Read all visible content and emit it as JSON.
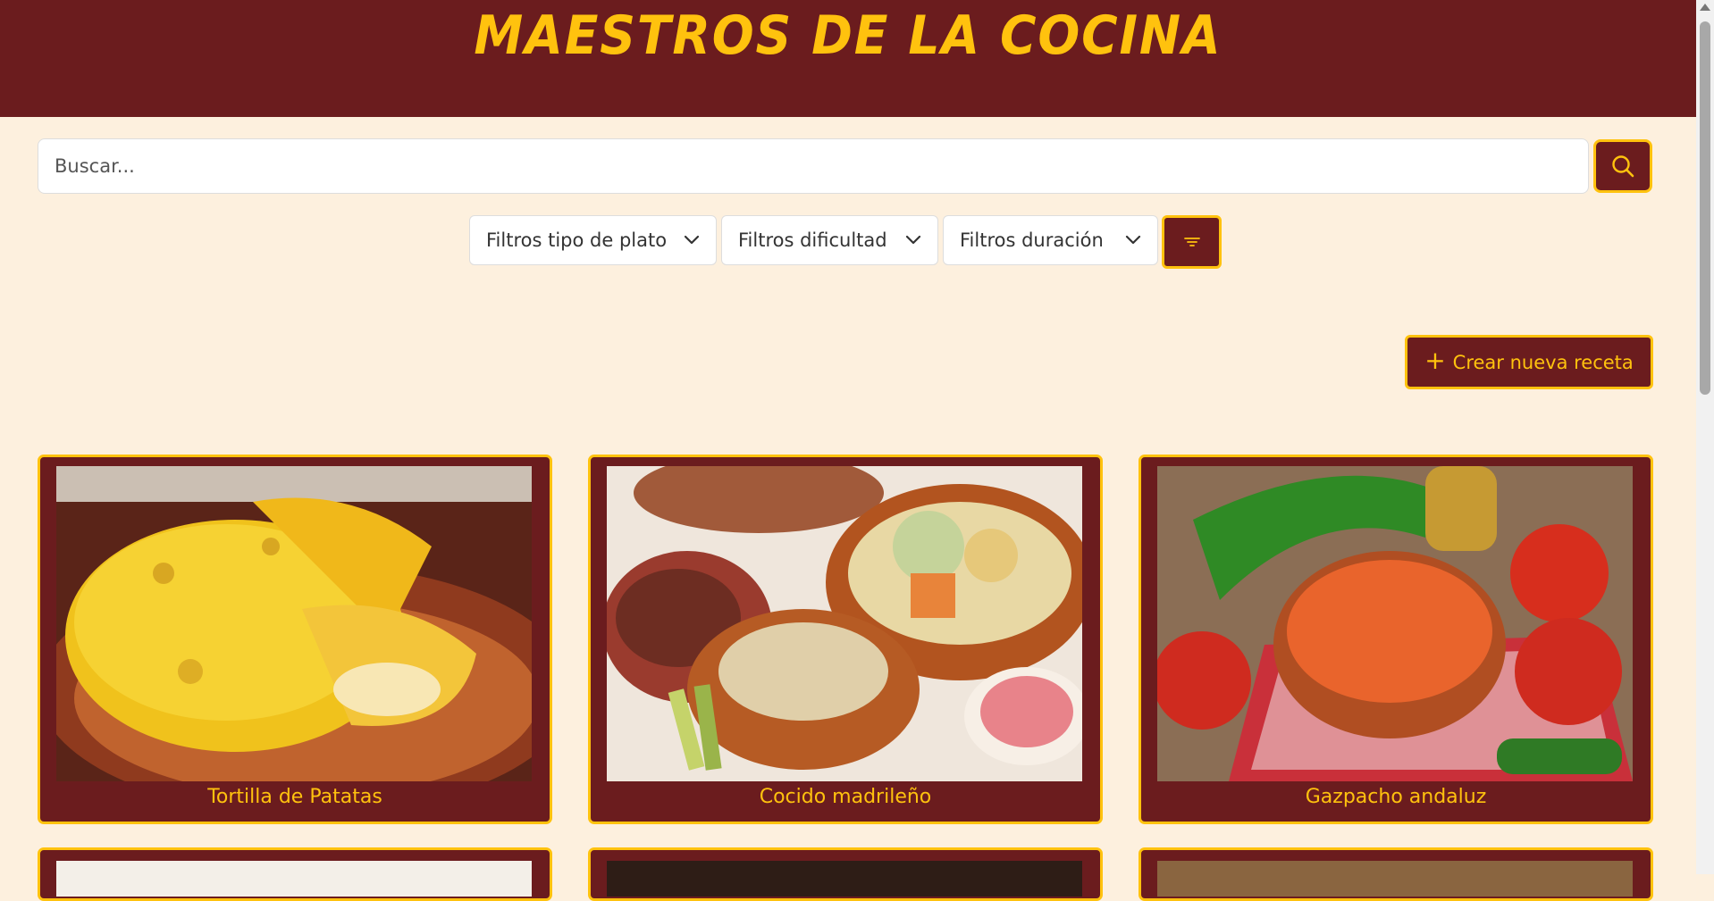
{
  "header": {
    "title": "MAESTROS DE LA COCINA"
  },
  "search": {
    "placeholder": "Buscar..."
  },
  "filters": [
    {
      "label": "Filtros tipo de plato"
    },
    {
      "label": "Filtros dificultad"
    },
    {
      "label": "Filtros duración"
    }
  ],
  "actions": {
    "create_label": "Crear nueva receta"
  },
  "recipes": [
    {
      "title": "Tortilla de Patatas"
    },
    {
      "title": "Cocido madrileño"
    },
    {
      "title": "Gazpacho andaluz"
    }
  ],
  "colors": {
    "brand": "#6b1c1e",
    "accent": "#ffc20e",
    "background": "#fdf0de"
  },
  "icons": {
    "search": "search-icon",
    "filter": "filter-icon",
    "chevron": "chevron-down-icon",
    "add": "plus-icon"
  }
}
